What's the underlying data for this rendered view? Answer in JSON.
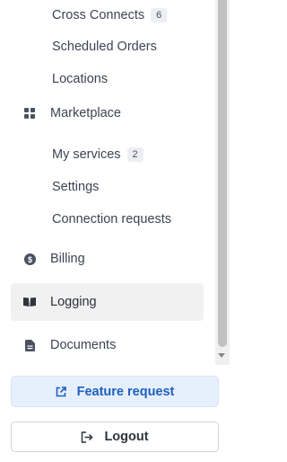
{
  "nav": {
    "cross_connects": {
      "label": "Cross Connects",
      "count": "6"
    },
    "scheduled_orders": {
      "label": "Scheduled Orders"
    },
    "locations": {
      "label": "Locations"
    },
    "marketplace": {
      "label": "Marketplace",
      "icon": "grid-icon"
    },
    "my_services": {
      "label": "My services",
      "count": "2"
    },
    "settings": {
      "label": "Settings"
    },
    "connection_requests": {
      "label": "Connection requests"
    },
    "billing": {
      "label": "Billing",
      "icon": "dollar-circle-icon"
    },
    "logging": {
      "label": "Logging",
      "icon": "book-open-icon",
      "active": true
    },
    "documents": {
      "label": "Documents",
      "icon": "document-icon"
    }
  },
  "footer": {
    "feature_request": {
      "label": "Feature request",
      "icon": "external-link-icon"
    },
    "logout": {
      "label": "Logout",
      "icon": "logout-icon"
    }
  },
  "colors": {
    "text": "#3d4452",
    "icon": "#4a5160",
    "active_bg": "#f1f1f1",
    "feature_bg": "#e6f0fc",
    "feature_text": "#1f5fbf"
  }
}
